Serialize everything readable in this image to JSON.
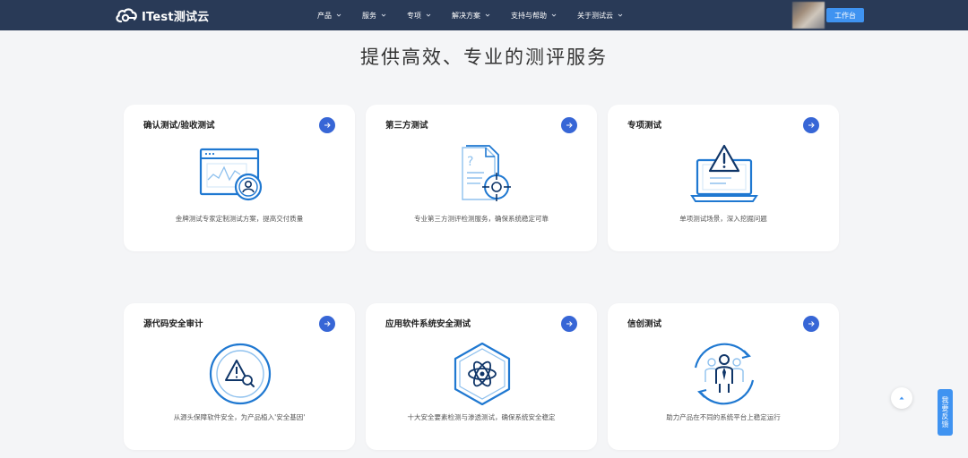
{
  "header": {
    "logo_text": "ITest测试云",
    "menu": [
      {
        "label": "产品"
      },
      {
        "label": "服务"
      },
      {
        "label": "专项"
      },
      {
        "label": "解决方案"
      },
      {
        "label": "支持与帮助"
      },
      {
        "label": "关于测试云"
      }
    ],
    "workbench_label": "工作台"
  },
  "main": {
    "title": "提供高效、专业的测评服务",
    "cards": [
      {
        "title": "确认测试/验收测试",
        "desc": "金牌测试专家定制测试方案，提高交付质量",
        "icon": "browser-user-icon"
      },
      {
        "title": "第三方测试",
        "desc": "专业第三方测评检测服务，确保系统稳定可靠",
        "icon": "document-target-icon"
      },
      {
        "title": "专项测试",
        "desc": "单项测试场景，深入挖掘问题",
        "icon": "laptop-warning-icon"
      },
      {
        "title": "源代码安全审计",
        "desc": "从源头保障软件安全，为产品植入'安全基因'",
        "icon": "warning-search-icon"
      },
      {
        "title": "应用软件系统安全测试",
        "desc": "十大安全要素检测与渗透测试，确保系统安全稳定",
        "icon": "hexagon-atom-icon"
      },
      {
        "title": "信创测试",
        "desc": "助力产品在不同的系统平台上稳定运行",
        "icon": "people-cycle-icon"
      }
    ]
  },
  "floating": {
    "feedback_label": "我要反馈"
  },
  "colors": {
    "nav_bg": "#293a57",
    "accent": "#3766d6",
    "button_blue": "#3f93f1",
    "icon_blue": "#1f78d1"
  }
}
